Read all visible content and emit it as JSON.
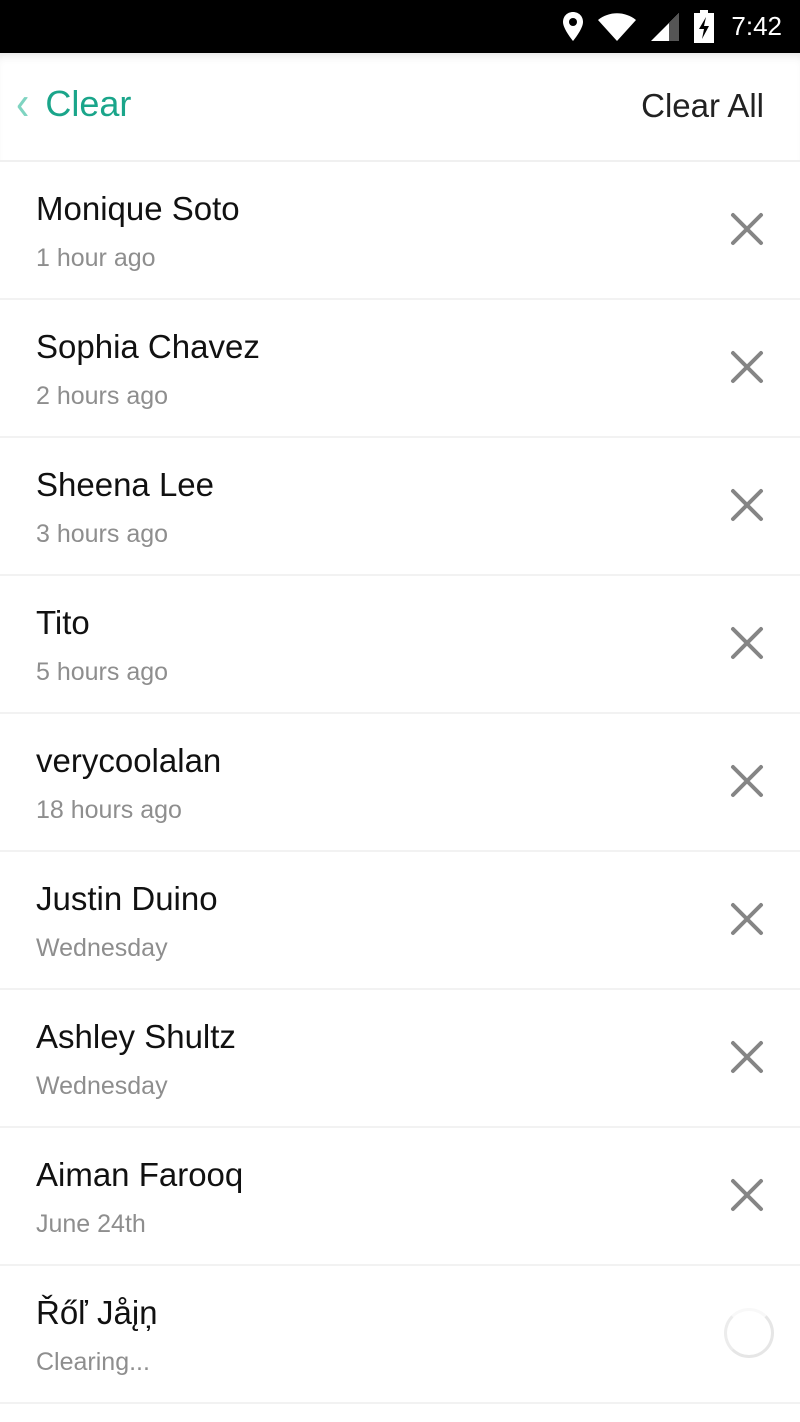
{
  "status_bar": {
    "time": "7:42",
    "icons": [
      "location-icon",
      "wifi-icon",
      "signal-icon",
      "battery-charging-icon"
    ]
  },
  "header": {
    "back_label": "Clear",
    "action_label": "Clear All",
    "accent_color": "#1aa58a"
  },
  "items": [
    {
      "name": "Monique Soto",
      "time": "1 hour ago",
      "state": "clearable"
    },
    {
      "name": "Sophia Chavez",
      "time": "2 hours ago",
      "state": "clearable"
    },
    {
      "name": "Sheena Lee",
      "time": "3 hours ago",
      "state": "clearable"
    },
    {
      "name": "Tito",
      "time": "5 hours ago",
      "state": "clearable"
    },
    {
      "name": "verycoolalan",
      "time": "18 hours ago",
      "state": "clearable"
    },
    {
      "name": "Justin Duino",
      "time": "Wednesday",
      "state": "clearable"
    },
    {
      "name": "Ashley Shultz",
      "time": "Wednesday",
      "state": "clearable"
    },
    {
      "name": "Aiman Farooq",
      "time": "June 24th",
      "state": "clearable"
    },
    {
      "name": "Řőľ Jåįņ",
      "time": "Clearing...",
      "state": "clearing"
    }
  ]
}
